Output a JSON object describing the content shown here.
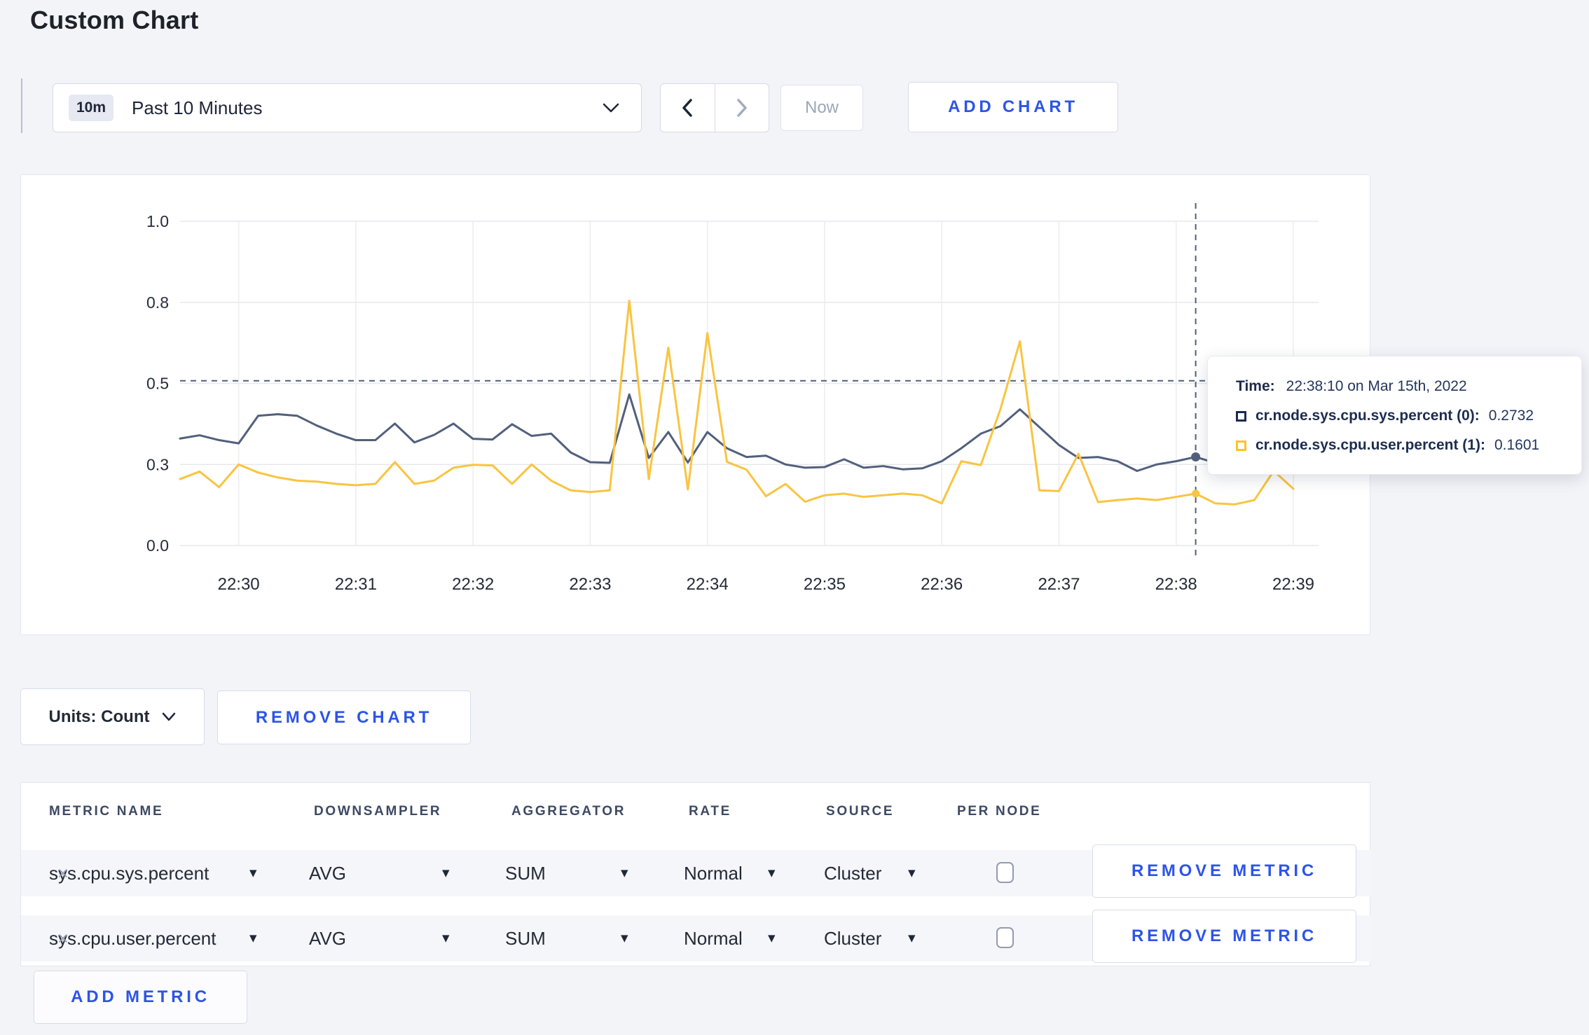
{
  "page": {
    "title": "Custom Chart"
  },
  "toolbar": {
    "time_range": {
      "badge": "10m",
      "label": "Past 10 Minutes"
    },
    "now_label": "Now",
    "add_chart_label": "ADD CHART"
  },
  "chart": {
    "tooltip": {
      "time_label": "Time:",
      "time_value": "22:38:10 on Mar 15th, 2022",
      "series": [
        {
          "name": "cr.node.sys.cpu.sys.percent (0):",
          "value": "0.2732",
          "swatch_color": "#1b2a4e"
        },
        {
          "name": "cr.node.sys.cpu.user.percent (1):",
          "value": "0.1601",
          "swatch_color": "#ffc325"
        }
      ]
    }
  },
  "chart_data": {
    "type": "line",
    "title": "",
    "xlabel": "",
    "ylabel": "",
    "ylim": [
      0,
      1
    ],
    "grid": true,
    "x_start": "22:29:30",
    "x_interval_seconds": 10,
    "x_tick_labels": [
      "22:30",
      "22:31",
      "22:32",
      "22:33",
      "22:34",
      "22:35",
      "22:36",
      "22:37",
      "22:38",
      "22:39"
    ],
    "x_tick_indices": [
      3,
      9,
      15,
      21,
      27,
      33,
      39,
      45,
      51,
      57
    ],
    "y_tick_values": [
      0,
      0.25,
      0.5,
      0.75,
      1.0
    ],
    "y_tick_labels": [
      "0.0",
      "0.3",
      "0.5",
      "0.8",
      "1.0"
    ],
    "series": [
      {
        "name": "cr.node.sys.cpu.sys.percent",
        "color": "#51607c",
        "values": [
          0.33,
          0.34,
          0.325,
          0.315,
          0.4,
          0.405,
          0.4,
          0.37,
          0.345,
          0.325,
          0.325,
          0.376,
          0.318,
          0.341,
          0.376,
          0.329,
          0.327,
          0.374,
          0.338,
          0.345,
          0.287,
          0.257,
          0.255,
          0.466,
          0.27,
          0.35,
          0.256,
          0.35,
          0.3,
          0.273,
          0.277,
          0.25,
          0.24,
          0.242,
          0.266,
          0.24,
          0.245,
          0.235,
          0.238,
          0.26,
          0.3,
          0.345,
          0.368,
          0.42,
          0.365,
          0.31,
          0.27,
          0.273,
          0.26,
          0.23,
          0.25,
          0.26,
          0.2732,
          0.255,
          0.26,
          0.28,
          0.27,
          0.26
        ]
      },
      {
        "name": "cr.node.sys.cpu.user.percent",
        "color": "#f9c440",
        "values": [
          0.205,
          0.228,
          0.18,
          0.25,
          0.225,
          0.21,
          0.2,
          0.197,
          0.19,
          0.186,
          0.19,
          0.257,
          0.19,
          0.2,
          0.24,
          0.249,
          0.247,
          0.19,
          0.25,
          0.2,
          0.17,
          0.165,
          0.17,
          0.755,
          0.205,
          0.61,
          0.173,
          0.655,
          0.258,
          0.234,
          0.152,
          0.19,
          0.135,
          0.155,
          0.16,
          0.15,
          0.155,
          0.16,
          0.155,
          0.13,
          0.26,
          0.248,
          0.42,
          0.63,
          0.17,
          0.168,
          0.283,
          0.134,
          0.14,
          0.145,
          0.14,
          0.15,
          0.1601,
          0.13,
          0.127,
          0.14,
          0.23,
          0.175
        ]
      }
    ],
    "crosshair": {
      "x_index": 52,
      "x_time": "22:38:10",
      "y_value": 0.508
    },
    "hover_points": [
      {
        "series": 0,
        "value": 0.2732
      },
      {
        "series": 1,
        "value": 0.1601
      }
    ],
    "legend_position": "none"
  },
  "chart_footer": {
    "units_label": "Units: Count",
    "remove_chart_label": "REMOVE CHART"
  },
  "metrics_table": {
    "headers": [
      "METRIC NAME",
      "DOWNSAMPLER",
      "AGGREGATOR",
      "RATE",
      "SOURCE",
      "PER NODE"
    ],
    "rows": [
      {
        "metric": "sys.cpu.sys.percent",
        "downsampler": "AVG",
        "aggregator": "SUM",
        "rate": "Normal",
        "source": "Cluster",
        "per_node_checked": false,
        "remove_label": "REMOVE METRIC"
      },
      {
        "metric": "sys.cpu.user.percent",
        "downsampler": "AVG",
        "aggregator": "SUM",
        "rate": "Normal",
        "source": "Cluster",
        "per_node_checked": false,
        "remove_label": "REMOVE METRIC"
      }
    ],
    "add_metric_label": "ADD METRIC"
  }
}
